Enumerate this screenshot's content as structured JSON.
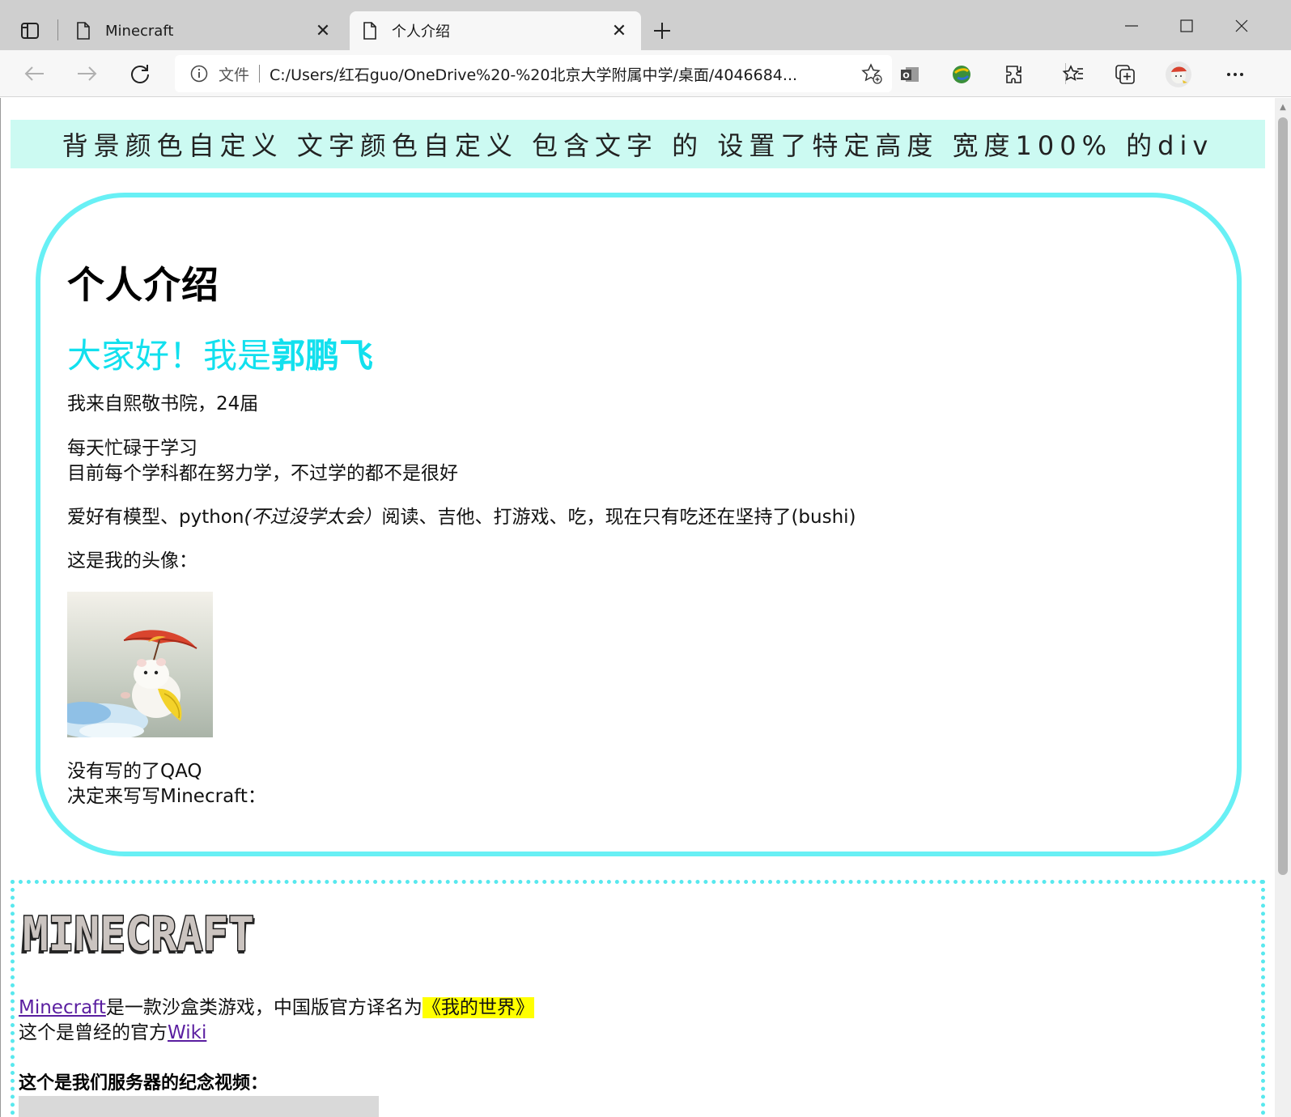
{
  "browser": {
    "tabs": [
      {
        "title": "Minecraft",
        "active": false
      },
      {
        "title": "个人介绍",
        "active": true
      }
    ],
    "address_bar": {
      "scheme_label": "文件",
      "url": "C:/Users/红石guo/OneDrive%20-%20北京大学附属中学/桌面/4046684..."
    }
  },
  "page": {
    "banner_text": "背景颜色自定义 文字颜色自定义 包含文字 的 设置了特定高度 宽度100% 的div",
    "intro": {
      "title": "个人介绍",
      "greeting_prefix": "大家好！我是",
      "greeting_name": "郭鹏飞",
      "line_1": "我来自熙敬书院，24届",
      "line_2": "每天忙碌于学习",
      "line_3": "目前每个学科都在努力学，不过学的都不是很好",
      "hobby_prefix": "爱好有模型、python",
      "hobby_italic": "(不过没学太会）",
      "hobby_suffix": "阅读、吉他、打游戏、吃，现在只有吃还在坚持了(bushi)",
      "avatar_label": "这是我的头像：",
      "line_4": "没有写的了QAQ",
      "line_5": "决定来写写Minecraft："
    },
    "minecraft": {
      "logo_text": "MINECRAFT",
      "link_text": "Minecraft",
      "desc_middle": "是一款沙盒类游戏，中国版官方译名为",
      "desc_highlight": "《我的世界》",
      "wiki_prefix": "这个是曾经的官方",
      "wiki_link": "Wiki",
      "video_title": "这个是我们服务器的纪念视频："
    }
  },
  "colors": {
    "banner_bg": "#ccfaf2",
    "card_border": "#68f0f5",
    "greeting": "#12e0ee",
    "link": "#5a1ea0",
    "highlight": "#ffff00"
  }
}
